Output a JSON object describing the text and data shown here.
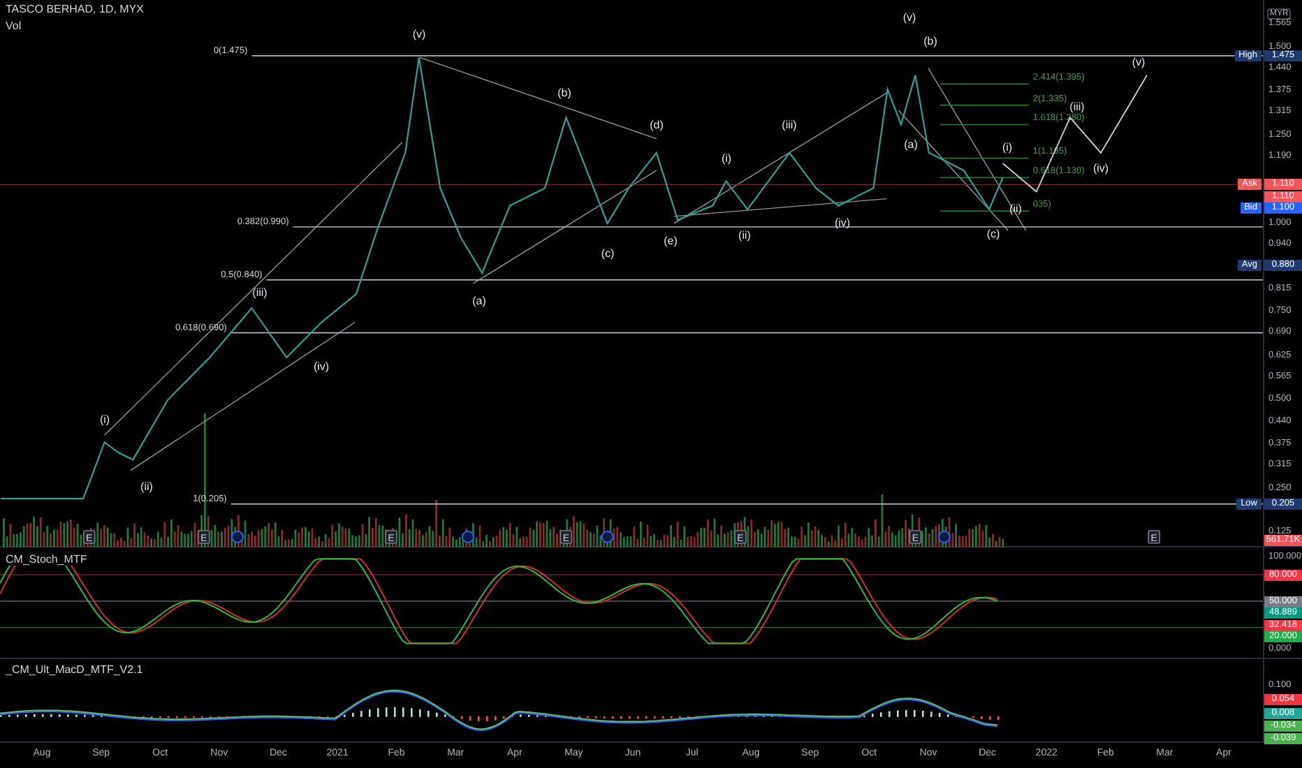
{
  "header": {
    "symbol": "TASCO BERHAD, 1D, MYX",
    "volume_label": "Vol"
  },
  "price_pane": {
    "currency": "MYR",
    "price_axis": [
      "1.565",
      "1.500",
      "1.440",
      "1.375",
      "1.315",
      "1.250",
      "1.190",
      "1.000",
      "0.940",
      "0.815",
      "0.750",
      "0.690",
      "0.625",
      "0.565",
      "0.500",
      "0.440",
      "0.375",
      "0.315",
      "0.250",
      "0.125"
    ],
    "wave_labels": [
      "(v)",
      "(iii)",
      "(iv)",
      "(i)",
      "(ii)",
      "(a)",
      "(b)",
      "(c)",
      "(d)",
      "(e)",
      "(i)",
      "(ii)",
      "(iii)",
      "(iv)",
      "(v)",
      "(b)",
      "(a)",
      "(c)",
      "(i)",
      "(ii)",
      "(iii)",
      "(iv)",
      "(v)"
    ],
    "fib_labels": [
      "0(1.475)",
      "0.382(0.990)",
      "0.5(0.840)",
      "0.618(0.690)",
      "1(0.205)",
      "2.414(1.395)",
      "2(1.335)",
      "1.618(1.280)",
      "1(1.185)",
      "0.618(1.130)",
      "035)"
    ],
    "price_tags": [
      {
        "kind": "high",
        "label": "High",
        "value": "1.475"
      },
      {
        "kind": "ask",
        "label": "Ask",
        "value": "1.110"
      },
      {
        "kind": "last",
        "value": "1.110"
      },
      {
        "kind": "bid",
        "label": "Bid",
        "value": "1.100"
      },
      {
        "kind": "avg",
        "label": "Avg",
        "value": "0.880"
      },
      {
        "kind": "low",
        "label": "Low",
        "value": "0.205"
      },
      {
        "kind": "volume",
        "value": "561.71K"
      }
    ],
    "events": [
      {
        "kind": "earnings",
        "text": "E"
      },
      {
        "kind": "earnings",
        "text": "E"
      },
      {
        "kind": "dividend"
      },
      {
        "kind": "earnings",
        "text": "E"
      },
      {
        "kind": "dividend"
      },
      {
        "kind": "earnings",
        "text": "E"
      },
      {
        "kind": "dividend"
      },
      {
        "kind": "earnings",
        "text": "E"
      },
      {
        "kind": "earnings",
        "text": "E"
      },
      {
        "kind": "dividend"
      },
      {
        "kind": "earnings",
        "text": "E"
      }
    ]
  },
  "stoch_pane": {
    "title": "CM_Stoch_MTF",
    "axis_labels": [
      {
        "text": "100.000"
      },
      {
        "text": "80.000",
        "color": "#f23645"
      },
      {
        "text": "50.000",
        "color": "#787b86"
      },
      {
        "text": "48.889",
        "color": "#089981"
      },
      {
        "text": "32.418",
        "color": "#f23645"
      },
      {
        "text": "20.000",
        "color": "#22ab4a"
      },
      {
        "text": "0.000"
      }
    ]
  },
  "macd_pane": {
    "title": "_CM_Ult_MacD_MTF_V2.1",
    "axis_labels": [
      {
        "text": "0.100"
      },
      {
        "text": "0.054",
        "color": "#f23645"
      },
      {
        "text": "0.008",
        "color": "#26a69a"
      },
      {
        "text": "-0.034",
        "color": "#4caf50"
      },
      {
        "text": "-0.039",
        "color": "#4caf50"
      }
    ]
  },
  "time_axis": [
    "Aug",
    "Sep",
    "Oct",
    "Nov",
    "Dec",
    "2021",
    "Feb",
    "Mar",
    "Apr",
    "May",
    "Jun",
    "Jul",
    "Aug",
    "Sep",
    "Oct",
    "Nov",
    "Dec",
    "2022",
    "Feb",
    "Mar",
    "Apr"
  ]
}
